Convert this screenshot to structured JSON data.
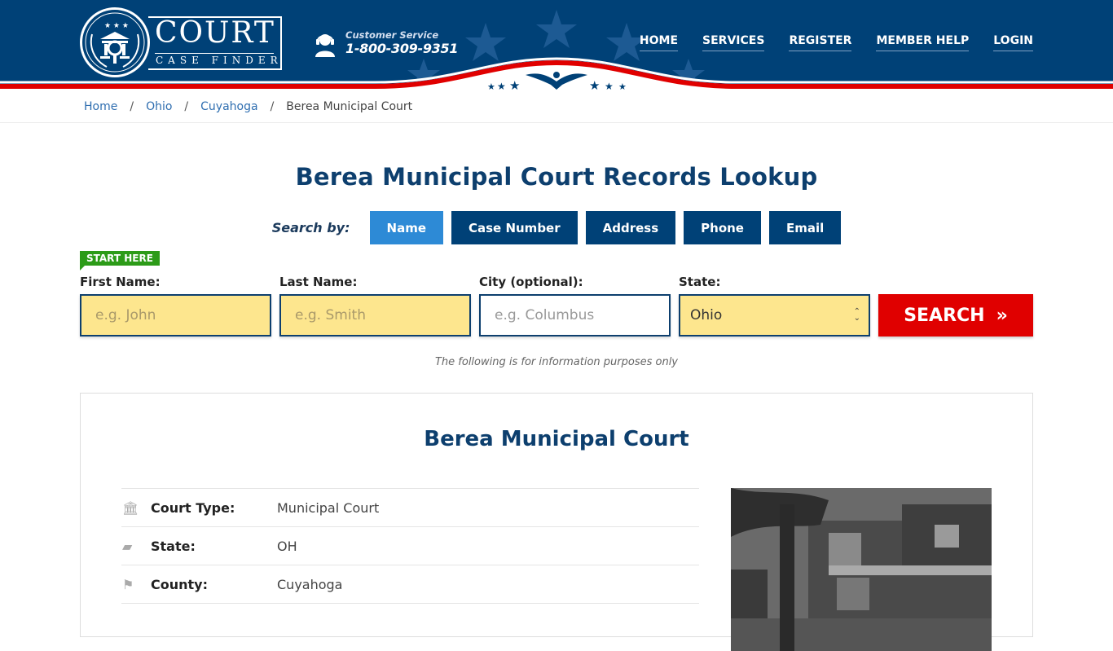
{
  "header": {
    "logo": {
      "title": "COURT",
      "subtitle": "CASE FINDER"
    },
    "customer_service": {
      "label": "Customer Service",
      "phone": "1-800-309-9351",
      "icon": "headset-icon"
    },
    "nav": [
      {
        "label": "HOME"
      },
      {
        "label": "SERVICES"
      },
      {
        "label": "REGISTER"
      },
      {
        "label": "MEMBER HELP"
      },
      {
        "label": "LOGIN"
      }
    ],
    "colors": {
      "primary": "#004177",
      "accent_red": "#e00000"
    }
  },
  "breadcrumb": [
    {
      "label": "Home"
    },
    {
      "label": "Ohio"
    },
    {
      "label": "Cuyahoga"
    },
    {
      "label": "Berea Municipal Court"
    }
  ],
  "page_title": "Berea Municipal Court Records Lookup",
  "search": {
    "search_by_label": "Search by:",
    "tabs": [
      {
        "label": "Name",
        "active": true
      },
      {
        "label": "Case Number"
      },
      {
        "label": "Address"
      },
      {
        "label": "Phone"
      },
      {
        "label": "Email"
      }
    ],
    "start_here": "START HERE",
    "fields": {
      "first_name": {
        "label": "First Name:",
        "placeholder": "e.g. John"
      },
      "last_name": {
        "label": "Last Name:",
        "placeholder": "e.g. Smith"
      },
      "city": {
        "label": "City (optional):",
        "placeholder": "e.g.  Columbus"
      },
      "state": {
        "label": "State:",
        "value": "Ohio"
      }
    },
    "button": "SEARCH",
    "note": "The following is for information purposes only"
  },
  "court": {
    "name": "Berea Municipal Court",
    "details": [
      {
        "icon": "courthouse-icon",
        "label": "Court Type:",
        "value": "Municipal Court"
      },
      {
        "icon": "us-map-icon",
        "label": "State:",
        "value": "OH"
      },
      {
        "icon": "flag-icon",
        "label": "County:",
        "value": "Cuyahoga"
      }
    ],
    "photo_alt": "Berea Municipal Court building"
  }
}
